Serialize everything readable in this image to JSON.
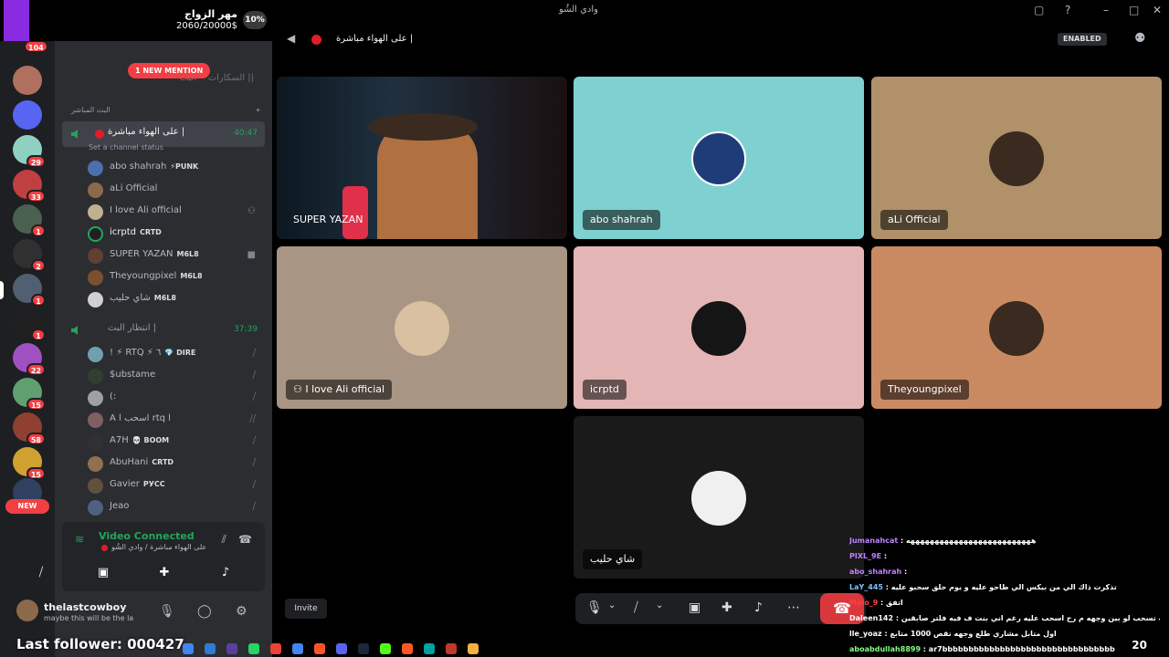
{
  "window": {
    "title": "وادي الشُو"
  },
  "marriage_widget": {
    "title": "مهر الزواج",
    "amount": "2060/20000$",
    "percent": "10%"
  },
  "rail": {
    "top_badge": "104",
    "badges": [
      "29",
      "33",
      "1",
      "2",
      "1",
      "1",
      "22",
      "15",
      "58",
      "15"
    ],
    "new_label": "NEW"
  },
  "sidebar": {
    "mention": "1 NEW MENTION",
    "faded_channel": "السكارات • البث ||",
    "category": "البث المباشر",
    "channel1": {
      "name": "على الهواء مباشرة |",
      "time": "40:47",
      "status": "Set a channel status",
      "members": [
        {
          "name": "abo shahrah",
          "tag": "⚡PUNK"
        },
        {
          "name": "aLi Official",
          "tag": ""
        },
        {
          "name": "I love Ali official",
          "tag": ""
        },
        {
          "name": "icrptd",
          "tag": "CRTD"
        },
        {
          "name": "SUPER YAZAN",
          "tag": "M6L8"
        },
        {
          "name": "Theyoungpixel",
          "tag": "M6L8"
        },
        {
          "name": "شاي حليب",
          "tag": "M6L8"
        }
      ]
    },
    "channel2": {
      "name": "انتظار البث |",
      "time": "37:39",
      "members": [
        {
          "name": "! ⚡ RTQ ⚡ ٦",
          "tag": "💎 DIRE"
        },
        {
          "name": "$ubstame",
          "tag": ""
        },
        {
          "name": "(:",
          "tag": ""
        },
        {
          "name": "A l اسحب rtq l",
          "tag": ""
        },
        {
          "name": "A7H",
          "tag": "💀 BOOM"
        },
        {
          "name": "AbuHani",
          "tag": "CRTD"
        },
        {
          "name": "Gavier",
          "tag": "РУСС"
        },
        {
          "name": "Jeao",
          "tag": ""
        }
      ]
    }
  },
  "voice_panel": {
    "connected": "Video Connected",
    "sub": "على الهواء مباشرة / وادي الشُو"
  },
  "user": {
    "name": "thelastcowboy",
    "status": "maybe this will be the la"
  },
  "header": {
    "channel": "على الهواء مباشرة |",
    "enabled": "ENABLED"
  },
  "tiles": [
    {
      "name": "SUPER YAZAN",
      "bg": "#1a2530"
    },
    {
      "name": "abo shahrah",
      "bg": "#7fd1d1"
    },
    {
      "name": "aLi Official",
      "bg": "#b0916a"
    },
    {
      "name": "I love Ali official",
      "bg": "#a89584"
    },
    {
      "name": "icrptd",
      "bg": "#e4b5b5"
    },
    {
      "name": "Theyoungpixel",
      "bg": "#c98a62"
    },
    {
      "name": "شاي حليب",
      "bg": "#1a1a1a"
    }
  ],
  "invite": "Invite",
  "chat": [
    {
      "user": "Jumanahcat",
      "color": "#c080ff",
      "msg": "ههههههههههههههههههههههههههه"
    },
    {
      "user": "PIXL_9E",
      "color": "#c080ff",
      "msg": ""
    },
    {
      "user": "abo_shahrah",
      "color": "#c080ff",
      "msg": ""
    },
    {
      "user": "LaY_445",
      "color": "#80c0ff",
      "msg": "تذكرت ذاك الي من بيكس الي طاحو عليه و يوم حلق سحبو عليه"
    },
    {
      "user": "Molo_9",
      "color": "#ff4040",
      "msg": "اتفق"
    },
    {
      "user": "Daleen142",
      "color": "#ffffff",
      "msg": "شف تسحب لو بين وجهه م رح اسحب عليه رغم اني بنت ف فيه فلتر صابقين"
    },
    {
      "user": "lle_yoaz",
      "color": "#ffffff",
      "msg": "اول متابل مشاري طلع وجهه نقص 1000 متابع"
    },
    {
      "user": "aboabdullah8899",
      "color": "#80ff80",
      "msg": "ar7bbbbbbbbbbbbbbbbbbbbbbbbbbbbbbbbb"
    }
  ],
  "last_follower": "Last follower: 000427",
  "clock": "20"
}
